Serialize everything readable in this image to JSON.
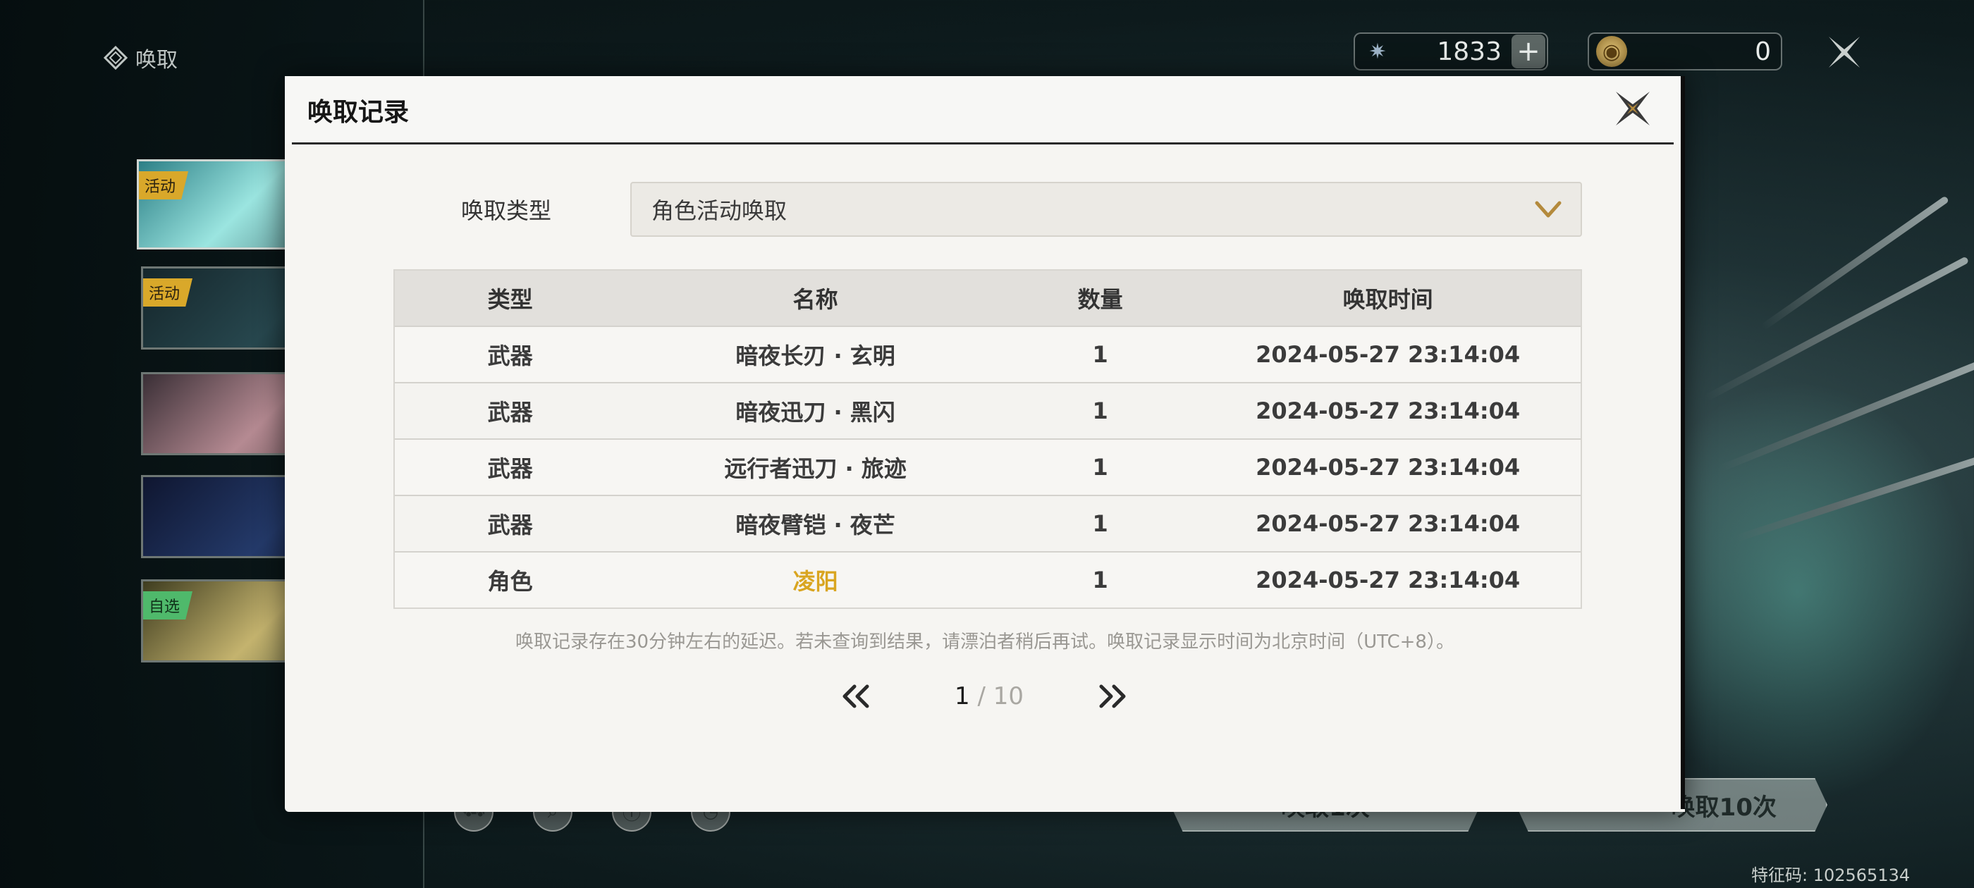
{
  "top_bar": {
    "title": "唤取",
    "title_icon": "diamond-emblem-icon",
    "currencies": [
      {
        "icon": "star-crystal-icon",
        "value": "1833",
        "has_add": true,
        "add_label": "+"
      },
      {
        "icon": "gold-coin-icon",
        "value": "0"
      }
    ],
    "close_icon": "close-icon"
  },
  "banners": [
    {
      "tag": "活动",
      "tag_color": "#d9a82a"
    },
    {
      "tag": "活动",
      "tag_color": "#d9a82a"
    },
    {
      "tag": ""
    },
    {
      "tag": ""
    },
    {
      "tag": "自选",
      "tag_color": "#4fb96b"
    }
  ],
  "bottom_buttons": {
    "pull_once": "唤取1次",
    "pull_ten": "唤取10次"
  },
  "feature_code": "特征码: 102565134",
  "modal": {
    "title": "唤取记录",
    "type_label": "唤取类型",
    "type_selected": "角色活动唤取",
    "columns": [
      "类型",
      "名称",
      "数量",
      "唤取时间"
    ],
    "rows": [
      {
        "type": "武器",
        "name": "暗夜长刃 · 玄明",
        "qty": "1",
        "time": "2024-05-27 23:14:04"
      },
      {
        "type": "武器",
        "name": "暗夜迅刀 · 黑闪",
        "qty": "1",
        "time": "2024-05-27 23:14:04"
      },
      {
        "type": "武器",
        "name": "远行者迅刀 · 旅迹",
        "qty": "1",
        "time": "2024-05-27 23:14:04"
      },
      {
        "type": "武器",
        "name": "暗夜臂铠 · 夜芒",
        "qty": "1",
        "time": "2024-05-27 23:14:04"
      },
      {
        "type": "角色",
        "name": "凌阳",
        "qty": "1",
        "time": "2024-05-27 23:14:04",
        "highlight": "#d9a520"
      }
    ],
    "note": "唤取记录存在30分钟左右的延迟。若未查询到结果，请漂泊者稍后再试。唤取记录显示时间为北京时间（UTC+8）。",
    "pager": {
      "current": "1",
      "separator": " / ",
      "total": "10"
    }
  },
  "colors": {
    "accent_gold": "#d9a520",
    "chevron": "#b48a3c",
    "modal_bg": "#f6f5f2"
  }
}
